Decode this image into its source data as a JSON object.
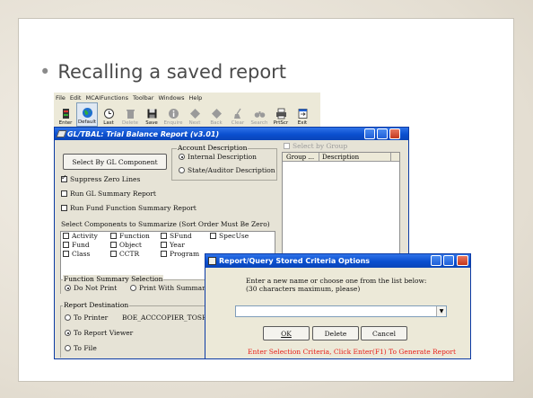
{
  "slide": {
    "title": "Recalling a saved report"
  },
  "menu": [
    "File",
    "Edit",
    "MCAIFunctions",
    "Toolbar",
    "Windows",
    "Help"
  ],
  "toolbar": [
    {
      "label": "Enter",
      "icon": "enter-icon",
      "enabled": true
    },
    {
      "label": "Default",
      "icon": "globe-icon",
      "enabled": true,
      "pressed": true
    },
    {
      "label": "Last",
      "icon": "clock-icon",
      "enabled": true
    },
    {
      "label": "Delete",
      "icon": "trash-icon",
      "enabled": false
    },
    {
      "label": "Save",
      "icon": "floppy-icon",
      "enabled": true
    },
    {
      "label": "Enquire",
      "icon": "info-icon",
      "enabled": false
    },
    {
      "label": "Next",
      "icon": "diamond-icon",
      "enabled": false
    },
    {
      "label": "Back",
      "icon": "diamond-icon",
      "enabled": false
    },
    {
      "label": "Clear",
      "icon": "broom-icon",
      "enabled": false
    },
    {
      "label": "Search",
      "icon": "binoculars-icon",
      "enabled": false
    },
    {
      "label": "PrtScr",
      "icon": "printer-icon",
      "enabled": true
    },
    {
      "label": "Exit",
      "icon": "exit-icon",
      "enabled": true
    }
  ],
  "main_window": {
    "title": "GL/TBAL: Trial Balance Report (v3.01)",
    "select_by_gl_button": "Select By GL Component",
    "account_description": {
      "legend": "Account Description",
      "options": [
        "Internal Description",
        "State/Auditor Description"
      ],
      "selected": "Internal Description"
    },
    "select_by_group": "Select by Group",
    "grid_headers": [
      "Group ...",
      "Description"
    ],
    "checkboxes": [
      {
        "label": "Suppress Zero Lines",
        "checked": true
      },
      {
        "label": "Run GL Summary Report",
        "checked": false
      },
      {
        "label": "Run Fund Function Summary Report",
        "checked": false
      }
    ],
    "components_label": "Select Components to Summarize (Sort Order Must Be Zero)",
    "components": [
      [
        "Activity",
        "Function",
        "SFund",
        "SpecUse"
      ],
      [
        "Fund",
        "Object",
        "Year"
      ],
      [
        "Class",
        "CCTR",
        "Program"
      ]
    ],
    "function_summary": {
      "legend": "Function Summary Selection",
      "options": [
        "Do Not Print",
        "Print With Summary"
      ],
      "selected": "Do Not Print"
    },
    "report_destination": {
      "legend": "Report Destination",
      "options": [
        "To Printer",
        "To Report Viewer",
        "To File"
      ],
      "printer_name": "BOE_ACCCOPIER_TOSHIB",
      "selected": "To Report Viewer"
    }
  },
  "dialog": {
    "title": "Report/Query Stored Criteria Options",
    "prompt_line1": "Enter a new name or choose one from the list below:",
    "prompt_line2": "(30 characters maximum, please)",
    "combo_value": "",
    "ok_label": "OK",
    "delete_label": "Delete",
    "cancel_label": "Cancel",
    "status": "Enter Selection Criteria, Click Enter(F1) To Generate Report",
    "status_color": "#e8201a"
  }
}
